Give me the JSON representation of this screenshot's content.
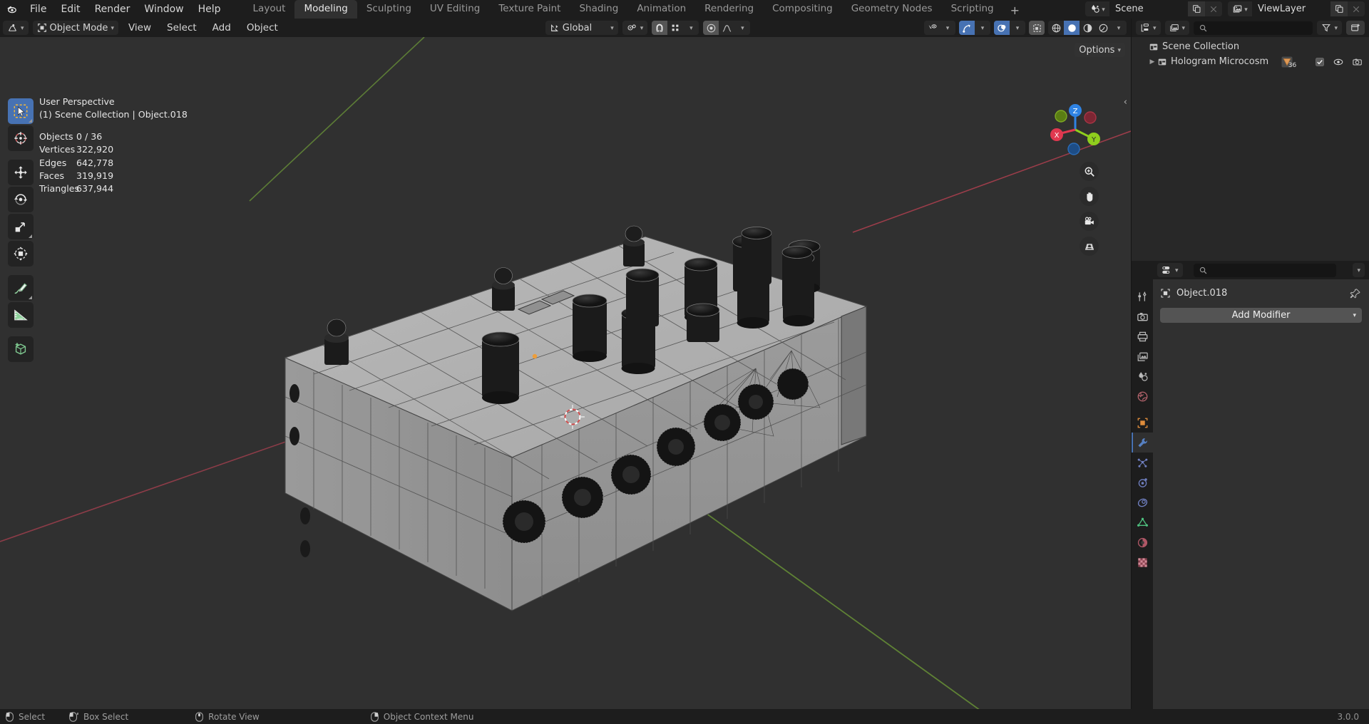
{
  "app": {
    "version": "3.0.0",
    "accent": "#4772b3",
    "bg_viewport": "#303030",
    "bg_panel": "#1d1d1d"
  },
  "topbar": {
    "logo": "blender-logo",
    "menus": [
      "File",
      "Edit",
      "Render",
      "Window",
      "Help"
    ],
    "workspaces": [
      {
        "label": "Layout",
        "active": false
      },
      {
        "label": "Modeling",
        "active": true
      },
      {
        "label": "Sculpting",
        "active": false
      },
      {
        "label": "UV Editing",
        "active": false
      },
      {
        "label": "Texture Paint",
        "active": false
      },
      {
        "label": "Shading",
        "active": false
      },
      {
        "label": "Animation",
        "active": false
      },
      {
        "label": "Rendering",
        "active": false
      },
      {
        "label": "Compositing",
        "active": false
      },
      {
        "label": "Geometry Nodes",
        "active": false
      },
      {
        "label": "Scripting",
        "active": false
      }
    ],
    "add_workspace": "+",
    "scene": {
      "icon": "scene-icon",
      "name": "Scene",
      "new_label": "new-scene-icon",
      "unlink_label": "x"
    },
    "viewlayer": {
      "icon": "viewlayer-icon",
      "name": "ViewLayer",
      "new_label": "new-viewlayer-icon",
      "unlink_label": "x"
    }
  },
  "viewport": {
    "header": {
      "editor_type": "editor-type-icon",
      "mode": "Object Mode",
      "menus": [
        "View",
        "Select",
        "Add",
        "Object"
      ],
      "transform_orientation": "Global",
      "pivot": "pivot-icon",
      "snap": "snap-magnet-icon",
      "proportional_edit": "proportional-edit-icon",
      "falloff": "falloff-icon",
      "options": "Options"
    },
    "overlay_stats": {
      "perspective": "User Perspective",
      "collection_line": "(1) Scene Collection | Object.018",
      "rows": [
        {
          "label": "Objects",
          "value": "0 / 36"
        },
        {
          "label": "Vertices",
          "value": "322,920"
        },
        {
          "label": "Edges",
          "value": "642,778"
        },
        {
          "label": "Faces",
          "value": "319,919"
        },
        {
          "label": "Triangles",
          "value": "637,944"
        }
      ]
    },
    "toolbar": [
      {
        "name": "tweak-select-box-tool",
        "active": true
      },
      {
        "name": "cursor-tool",
        "active": false
      },
      {
        "name": "move-tool",
        "active": false
      },
      {
        "name": "rotate-tool",
        "active": false
      },
      {
        "name": "scale-tool",
        "active": false
      },
      {
        "name": "transform-tool",
        "active": false
      },
      {
        "name": "annotate-tool",
        "active": false
      },
      {
        "name": "measure-tool",
        "active": false
      },
      {
        "name": "add-cube-tool",
        "active": false
      }
    ],
    "gizmo": {
      "axes": [
        {
          "label": "Z",
          "color": "#2f83e3"
        },
        {
          "label": "Y",
          "color": "#8fce1d"
        },
        {
          "label": "X",
          "color": "#e0384f"
        }
      ]
    },
    "nav_buttons": [
      "zoom-icon",
      "pan-hand-icon",
      "camera-icon",
      "ortho-persp-icon"
    ],
    "shading_modes": [
      "wireframe-shading",
      "solid-shading",
      "material-shading",
      "rendered-shading"
    ],
    "shading_active_index": 1
  },
  "outliner": {
    "display_mode": "outliner-display-mode-icon",
    "filter_id": "view-layer-icon",
    "search_placeholder": "",
    "filter_icon": "filter-funnel-icon",
    "new_collection_icon": "new-collection-icon",
    "rows": [
      {
        "name": "Scene Collection",
        "icon": "collection-icon",
        "depth": 0,
        "expandable": false
      },
      {
        "name": "Hologram Microcosm",
        "icon": "collection-icon",
        "depth": 1,
        "expandable": true,
        "badge": "36",
        "badge_icon": "mesh-data-icon",
        "checkbox": true,
        "eye": "eye-icon",
        "camera": "camera-render-icon"
      }
    ]
  },
  "properties": {
    "editor_icon": "properties-editor-icon",
    "search_placeholder": "",
    "tabs": [
      {
        "name": "tool-tab",
        "icon": "tool-icon",
        "active": false
      },
      {
        "name": "render-tab",
        "icon": "render-camera-icon",
        "active": false
      },
      {
        "name": "output-tab",
        "icon": "printer-icon",
        "active": false
      },
      {
        "name": "viewlayer-tab",
        "icon": "images-icon",
        "active": false
      },
      {
        "name": "scene-tab",
        "icon": "scene-cone-icon",
        "active": false
      },
      {
        "name": "world-tab",
        "icon": "world-globe-icon",
        "active": false
      },
      {
        "name": "object-tab",
        "icon": "object-square-icon",
        "active": false
      },
      {
        "name": "modifier-tab",
        "icon": "wrench-icon",
        "active": true
      },
      {
        "name": "particles-tab",
        "icon": "particles-icon",
        "active": false
      },
      {
        "name": "physics-tab",
        "icon": "physics-orbit-icon",
        "active": false
      },
      {
        "name": "constraints-tab",
        "icon": "constraint-icon",
        "active": false
      },
      {
        "name": "data-tab",
        "icon": "mesh-data-triangle-icon",
        "active": false
      },
      {
        "name": "material-tab",
        "icon": "material-sphere-icon",
        "active": false
      },
      {
        "name": "texture-tab",
        "icon": "texture-checker-icon",
        "active": false
      }
    ],
    "breadcrumb_icon": "object-square-icon",
    "breadcrumb": "Object.018",
    "pin_icon": "pin-icon",
    "add_modifier": "Add Modifier"
  },
  "statusbar": {
    "items": [
      {
        "icon": "mouse-left-icon",
        "label": "Select"
      },
      {
        "icon": "mouse-left-drag-icon",
        "label": "Box Select"
      },
      {
        "icon": "mouse-middle-icon",
        "label": "Rotate View"
      },
      {
        "icon": "mouse-right-icon",
        "label": "Object Context Menu"
      }
    ],
    "version": "3.0.0"
  }
}
